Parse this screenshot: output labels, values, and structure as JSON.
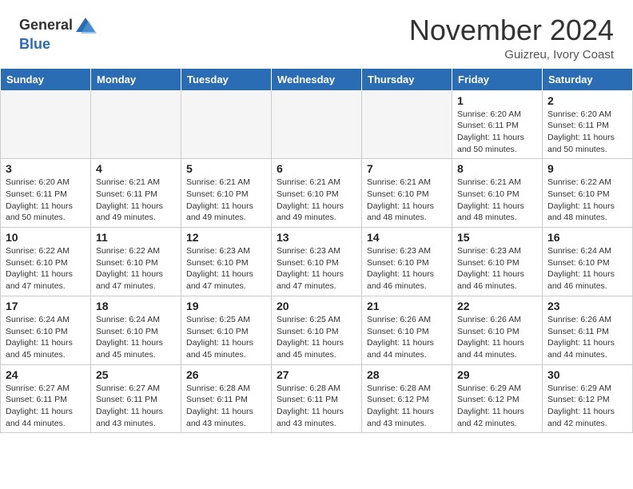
{
  "header": {
    "logo_general": "General",
    "logo_blue": "Blue",
    "month": "November 2024",
    "location": "Guizreu, Ivory Coast"
  },
  "weekdays": [
    "Sunday",
    "Monday",
    "Tuesday",
    "Wednesday",
    "Thursday",
    "Friday",
    "Saturday"
  ],
  "weeks": [
    [
      {
        "day": "",
        "info": ""
      },
      {
        "day": "",
        "info": ""
      },
      {
        "day": "",
        "info": ""
      },
      {
        "day": "",
        "info": ""
      },
      {
        "day": "",
        "info": ""
      },
      {
        "day": "1",
        "info": "Sunrise: 6:20 AM\nSunset: 6:11 PM\nDaylight: 11 hours and 50 minutes."
      },
      {
        "day": "2",
        "info": "Sunrise: 6:20 AM\nSunset: 6:11 PM\nDaylight: 11 hours and 50 minutes."
      }
    ],
    [
      {
        "day": "3",
        "info": "Sunrise: 6:20 AM\nSunset: 6:11 PM\nDaylight: 11 hours and 50 minutes."
      },
      {
        "day": "4",
        "info": "Sunrise: 6:21 AM\nSunset: 6:11 PM\nDaylight: 11 hours and 49 minutes."
      },
      {
        "day": "5",
        "info": "Sunrise: 6:21 AM\nSunset: 6:10 PM\nDaylight: 11 hours and 49 minutes."
      },
      {
        "day": "6",
        "info": "Sunrise: 6:21 AM\nSunset: 6:10 PM\nDaylight: 11 hours and 49 minutes."
      },
      {
        "day": "7",
        "info": "Sunrise: 6:21 AM\nSunset: 6:10 PM\nDaylight: 11 hours and 48 minutes."
      },
      {
        "day": "8",
        "info": "Sunrise: 6:21 AM\nSunset: 6:10 PM\nDaylight: 11 hours and 48 minutes."
      },
      {
        "day": "9",
        "info": "Sunrise: 6:22 AM\nSunset: 6:10 PM\nDaylight: 11 hours and 48 minutes."
      }
    ],
    [
      {
        "day": "10",
        "info": "Sunrise: 6:22 AM\nSunset: 6:10 PM\nDaylight: 11 hours and 47 minutes."
      },
      {
        "day": "11",
        "info": "Sunrise: 6:22 AM\nSunset: 6:10 PM\nDaylight: 11 hours and 47 minutes."
      },
      {
        "day": "12",
        "info": "Sunrise: 6:23 AM\nSunset: 6:10 PM\nDaylight: 11 hours and 47 minutes."
      },
      {
        "day": "13",
        "info": "Sunrise: 6:23 AM\nSunset: 6:10 PM\nDaylight: 11 hours and 47 minutes."
      },
      {
        "day": "14",
        "info": "Sunrise: 6:23 AM\nSunset: 6:10 PM\nDaylight: 11 hours and 46 minutes."
      },
      {
        "day": "15",
        "info": "Sunrise: 6:23 AM\nSunset: 6:10 PM\nDaylight: 11 hours and 46 minutes."
      },
      {
        "day": "16",
        "info": "Sunrise: 6:24 AM\nSunset: 6:10 PM\nDaylight: 11 hours and 46 minutes."
      }
    ],
    [
      {
        "day": "17",
        "info": "Sunrise: 6:24 AM\nSunset: 6:10 PM\nDaylight: 11 hours and 45 minutes."
      },
      {
        "day": "18",
        "info": "Sunrise: 6:24 AM\nSunset: 6:10 PM\nDaylight: 11 hours and 45 minutes."
      },
      {
        "day": "19",
        "info": "Sunrise: 6:25 AM\nSunset: 6:10 PM\nDaylight: 11 hours and 45 minutes."
      },
      {
        "day": "20",
        "info": "Sunrise: 6:25 AM\nSunset: 6:10 PM\nDaylight: 11 hours and 45 minutes."
      },
      {
        "day": "21",
        "info": "Sunrise: 6:26 AM\nSunset: 6:10 PM\nDaylight: 11 hours and 44 minutes."
      },
      {
        "day": "22",
        "info": "Sunrise: 6:26 AM\nSunset: 6:10 PM\nDaylight: 11 hours and 44 minutes."
      },
      {
        "day": "23",
        "info": "Sunrise: 6:26 AM\nSunset: 6:11 PM\nDaylight: 11 hours and 44 minutes."
      }
    ],
    [
      {
        "day": "24",
        "info": "Sunrise: 6:27 AM\nSunset: 6:11 PM\nDaylight: 11 hours and 44 minutes."
      },
      {
        "day": "25",
        "info": "Sunrise: 6:27 AM\nSunset: 6:11 PM\nDaylight: 11 hours and 43 minutes."
      },
      {
        "day": "26",
        "info": "Sunrise: 6:28 AM\nSunset: 6:11 PM\nDaylight: 11 hours and 43 minutes."
      },
      {
        "day": "27",
        "info": "Sunrise: 6:28 AM\nSunset: 6:11 PM\nDaylight: 11 hours and 43 minutes."
      },
      {
        "day": "28",
        "info": "Sunrise: 6:28 AM\nSunset: 6:12 PM\nDaylight: 11 hours and 43 minutes."
      },
      {
        "day": "29",
        "info": "Sunrise: 6:29 AM\nSunset: 6:12 PM\nDaylight: 11 hours and 42 minutes."
      },
      {
        "day": "30",
        "info": "Sunrise: 6:29 AM\nSunset: 6:12 PM\nDaylight: 11 hours and 42 minutes."
      }
    ]
  ]
}
